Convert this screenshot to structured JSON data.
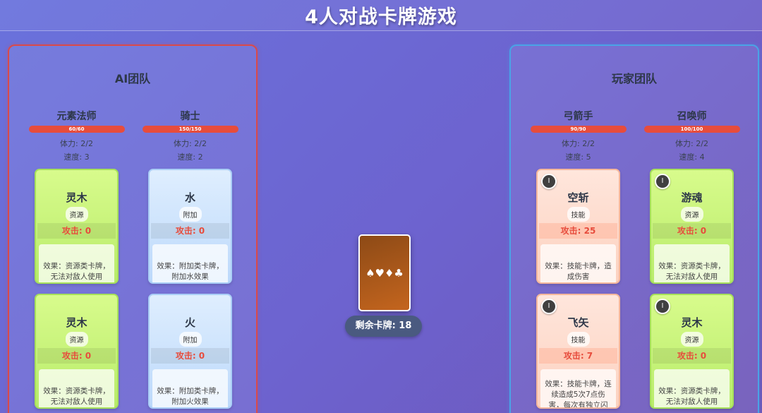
{
  "title": "4人对战卡牌游戏",
  "ai_team": {
    "title": "AI团队",
    "characters": [
      {
        "name": "元素法师",
        "hp": "60/60",
        "hp_fraction": 1.0,
        "stamina": "体力: 2/2",
        "speed": "速度: 3",
        "cards": [
          {
            "name": "灵木",
            "type": "资源",
            "attack": "攻击: 0",
            "effect": "效果：资源类卡牌，无法对敌人使用"
          },
          {
            "name": "灵木",
            "type": "资源",
            "attack": "攻击: 0",
            "effect": "效果：资源类卡牌，无法对敌人使用"
          }
        ]
      },
      {
        "name": "骑士",
        "hp": "150/150",
        "hp_fraction": 1.0,
        "stamina": "体力: 2/2",
        "speed": "速度: 2",
        "cards": [
          {
            "name": "水",
            "type": "附加",
            "attack": "攻击: 0",
            "effect": "效果：附加类卡牌，附加水效果"
          },
          {
            "name": "火",
            "type": "附加",
            "attack": "攻击: 0",
            "effect": "效果：附加类卡牌，附加火效果"
          }
        ]
      }
    ]
  },
  "player_team": {
    "title": "玩家团队",
    "characters": [
      {
        "name": "弓箭手",
        "hp": "90/90",
        "hp_fraction": 1.0,
        "stamina": "体力: 2/2",
        "speed": "速度: 5",
        "cards": [
          {
            "name": "空斩",
            "type": "技能",
            "attack": "攻击: 25",
            "effect": "效果：技能卡牌，造成伤害",
            "level": "I"
          },
          {
            "name": "飞矢",
            "type": "技能",
            "attack": "攻击: 7",
            "effect": "效果：技能卡牌，连续造成5次7点伤害，每次有独立闪",
            "level": "I"
          }
        ]
      },
      {
        "name": "召唤师",
        "hp": "100/100",
        "hp_fraction": 1.0,
        "stamina": "体力: 2/2",
        "speed": "速度: 4",
        "cards": [
          {
            "name": "游魂",
            "type": "资源",
            "attack": "攻击: 0",
            "effect": "效果：资源类卡牌，无法对敌人使用",
            "level": "I"
          },
          {
            "name": "灵木",
            "type": "资源",
            "attack": "攻击: 0",
            "effect": "效果：资源类卡牌，无法对敌人使用",
            "level": "I"
          }
        ]
      }
    ]
  },
  "deck": {
    "symbols": "♠♥♦♣",
    "remaining": "剩余卡牌: 18"
  },
  "colors": {
    "ai_border": "#d94a4a",
    "player_border": "#4aa3e6",
    "hp_bar": "#e74c3c",
    "attack_text": "#e74c3c",
    "resource_card": "#c8f57a",
    "attach_card": "#cfe3fd",
    "skill_card": "#fddccd"
  }
}
